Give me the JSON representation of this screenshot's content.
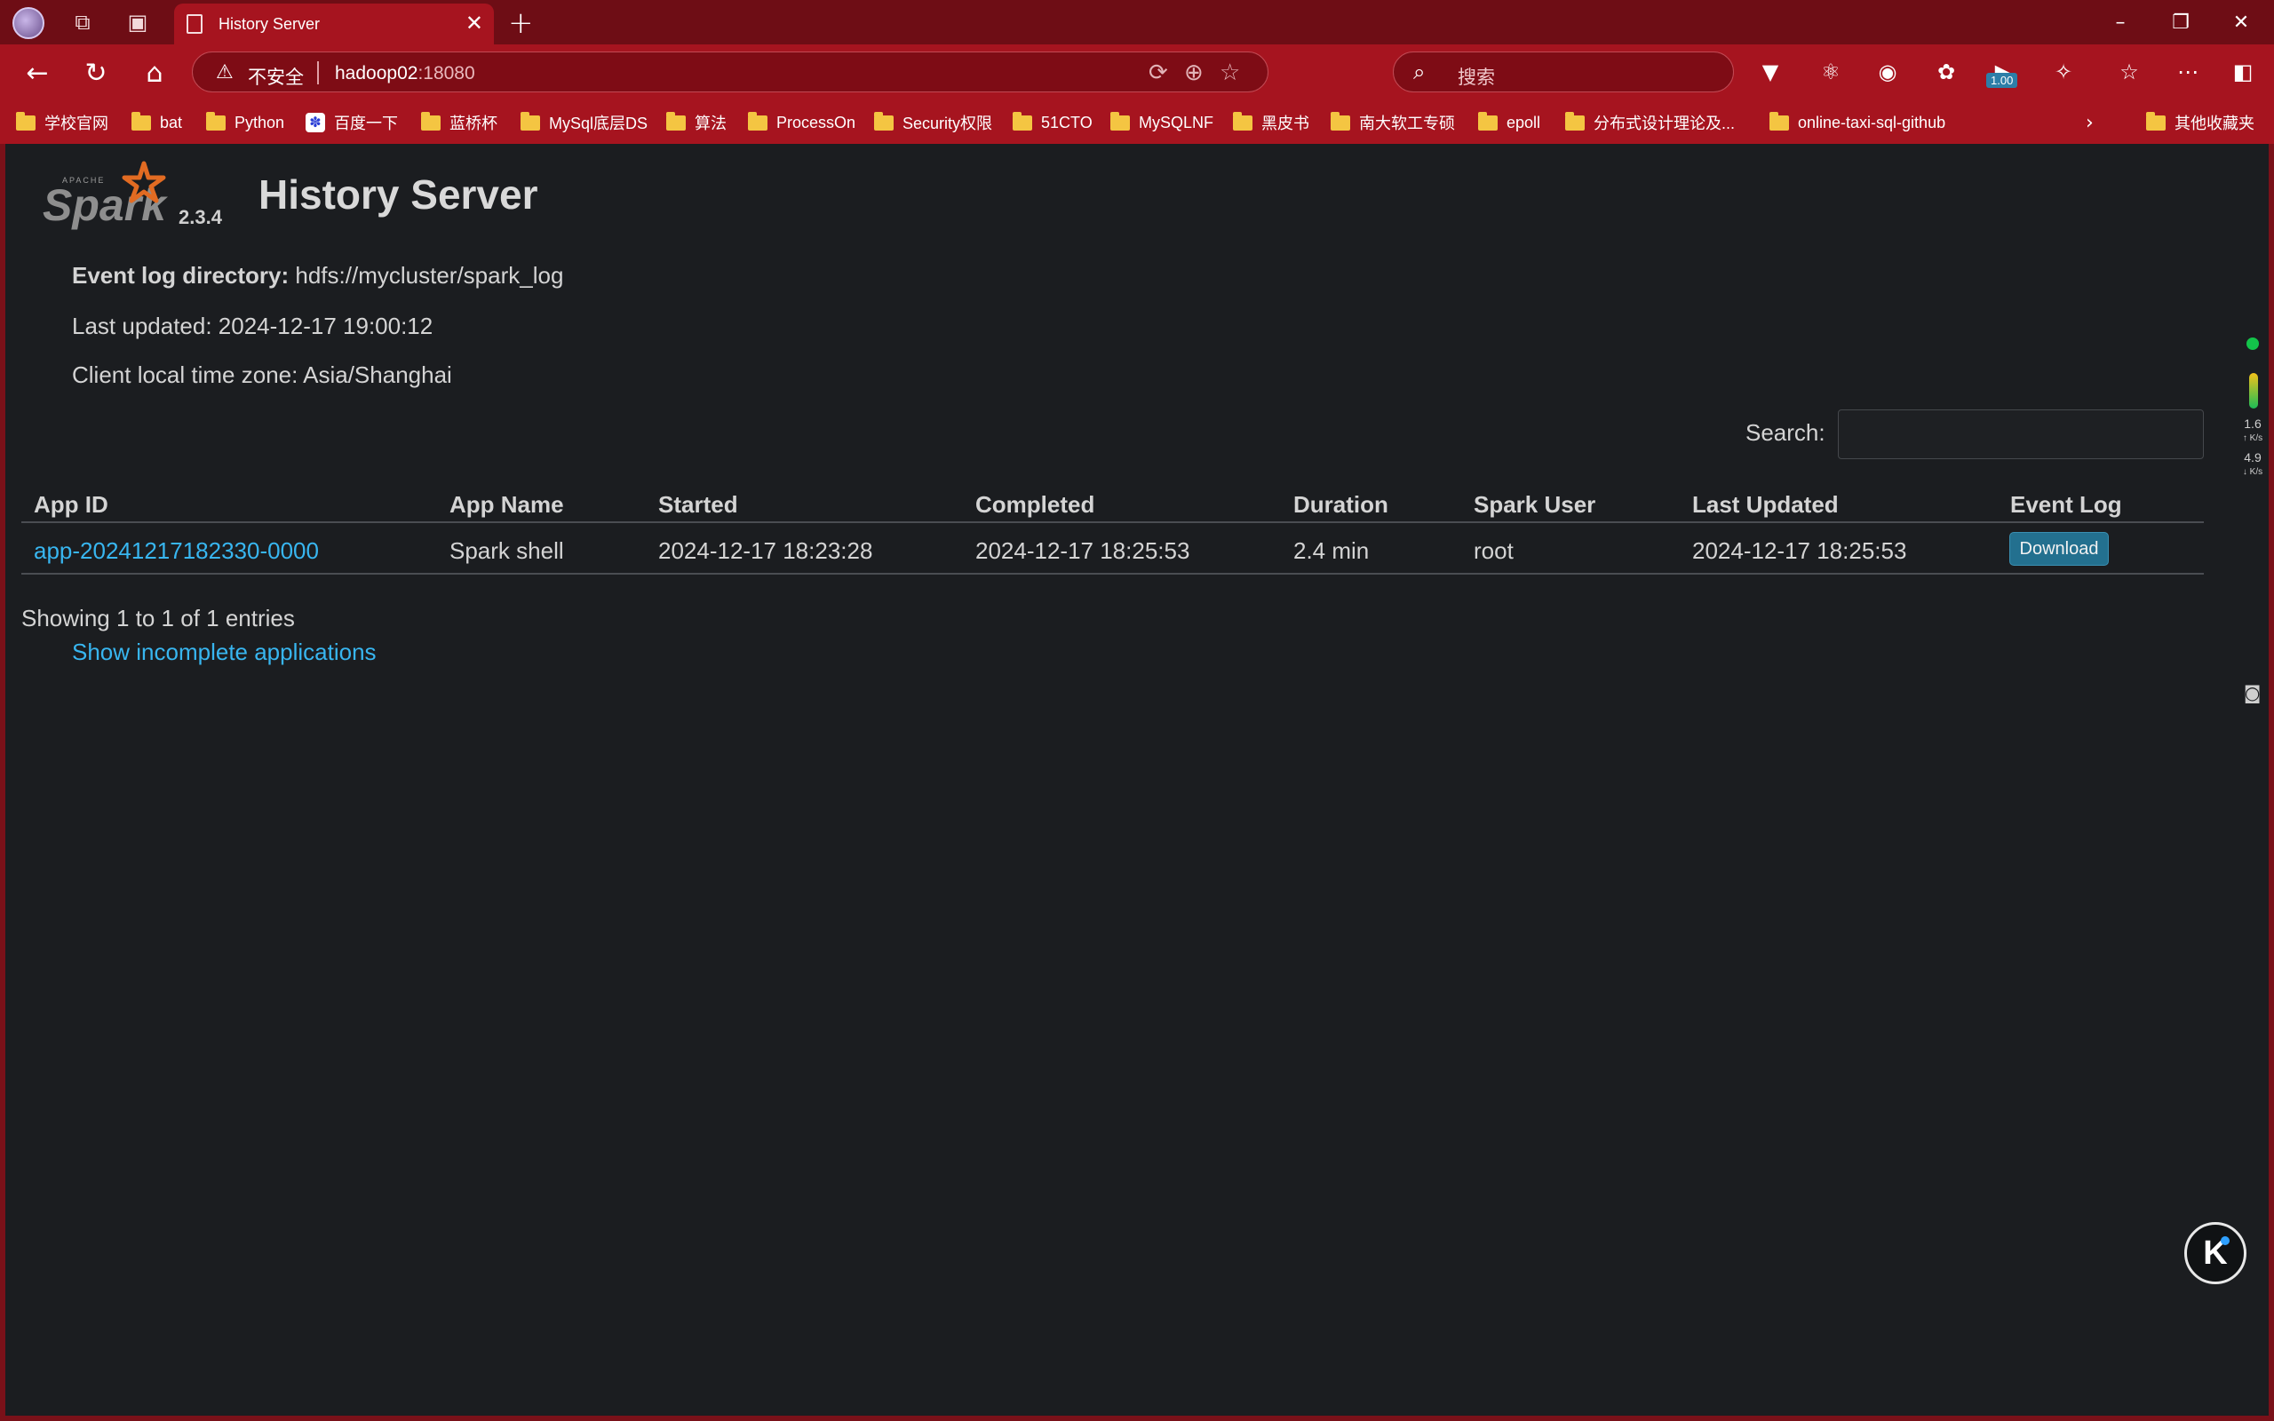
{
  "browser": {
    "tab_title": "History Server",
    "tab_close": "✕",
    "new_tab": "+",
    "url_insecure": "不安全",
    "url_host": "hadoop02",
    "url_port": ":18080",
    "search_placeholder": "搜索",
    "ext_badge": "1.00",
    "window_controls": [
      "–",
      "❐",
      "✕"
    ]
  },
  "bookmarks": [
    {
      "label": "学校官网",
      "icon": "folder"
    },
    {
      "label": "bat",
      "icon": "folder"
    },
    {
      "label": "Python",
      "icon": "folder"
    },
    {
      "label": "百度一下",
      "icon": "baidu-paw"
    },
    {
      "label": "蓝桥杯",
      "icon": "folder"
    },
    {
      "label": "MySql底层DS",
      "icon": "folder"
    },
    {
      "label": "算法",
      "icon": "folder"
    },
    {
      "label": "ProcessOn",
      "icon": "folder"
    },
    {
      "label": "Security权限",
      "icon": "folder"
    },
    {
      "label": "51CTO",
      "icon": "folder"
    },
    {
      "label": "MySQLNF",
      "icon": "folder"
    },
    {
      "label": "黑皮书",
      "icon": "folder"
    },
    {
      "label": "南大软工专硕",
      "icon": "folder"
    },
    {
      "label": "epoll",
      "icon": "folder"
    },
    {
      "label": "分布式设计理论及...",
      "icon": "folder"
    },
    {
      "label": "online-taxi-sql-github",
      "icon": "folder"
    },
    {
      "label": "其他收藏夹",
      "icon": "folder"
    }
  ],
  "page": {
    "logo_text": "Spark",
    "logo_apache": "APACHE",
    "version": "2.3.4",
    "title": "History Server",
    "event_log_label": "Event log directory:",
    "event_log_value": "hdfs://mycluster/spark_log",
    "last_updated": "Last updated: 2024-12-17 19:00:12",
    "timezone": "Client local time zone: Asia/Shanghai",
    "search_label": "Search:",
    "search_value": "",
    "showing": "Showing 1 to 1 of 1 entries",
    "incomplete_link": "Show incomplete applications"
  },
  "table": {
    "headers": [
      "App ID",
      "App Name",
      "Started",
      "Completed",
      "Duration",
      "Spark User",
      "Last Updated",
      "Event Log"
    ],
    "rows": [
      {
        "app_id": "app-20241217182330-0000",
        "app_name": "Spark shell",
        "started": "2024-12-17 18:23:28",
        "completed": "2024-12-17 18:25:53",
        "duration": "2.4 min",
        "user": "root",
        "last_updated": "2024-12-17 18:25:53",
        "event_log": "Download"
      }
    ]
  },
  "side_widget": {
    "up_speed": "1.6",
    "up_unit": "K/s",
    "down_speed": "4.9",
    "down_unit": "K/s"
  },
  "float_button": "K",
  "colors": {
    "chrome_red": "#a6141f",
    "page_bg": "#1b1d20",
    "link": "#38b6f0",
    "button": "#23708f"
  }
}
